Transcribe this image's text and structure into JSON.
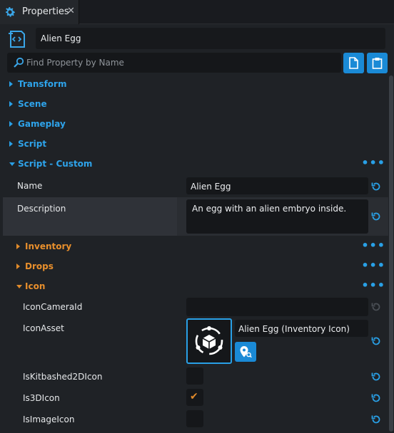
{
  "tab": {
    "title": "Properties",
    "close": "✕"
  },
  "object": {
    "name": "Alien Egg"
  },
  "search": {
    "placeholder": "Find Property by Name"
  },
  "sections": {
    "transform": "Transform",
    "scene": "Scene",
    "gameplay": "Gameplay",
    "script": "Script",
    "script_custom": "Script - Custom"
  },
  "props": {
    "name_label": "Name",
    "name_value": "Alien Egg",
    "description_label": "Description",
    "description_value": "An egg with an alien embryo inside."
  },
  "subsections": {
    "inventory": "Inventory",
    "drops": "Drops",
    "icon": "Icon"
  },
  "icon_props": {
    "camera_label": "IconCameraId",
    "camera_value": "",
    "asset_label": "IconAsset",
    "asset_value": "Alien Egg (Inventory Icon)",
    "kitbashed_label": "IsKitbashed2DIcon",
    "kitbashed_checked": false,
    "is3d_label": "Is3DIcon",
    "is3d_checked": true,
    "image_label": "IsImageIcon",
    "image_checked": false
  },
  "glyphs": {
    "more": "•••",
    "check": "✔"
  },
  "colors": {
    "accent_blue": "#29a0e6",
    "accent_orange": "#e88f2c",
    "background": "#1f2226",
    "field": "#15171a"
  },
  "icons": [
    "gear-icon",
    "close-icon",
    "script-icon",
    "search-icon",
    "paste-icon",
    "clipboard-icon",
    "reset-icon",
    "more-icon",
    "asset-cube-icon",
    "locate-asset-icon",
    "check-icon"
  ]
}
